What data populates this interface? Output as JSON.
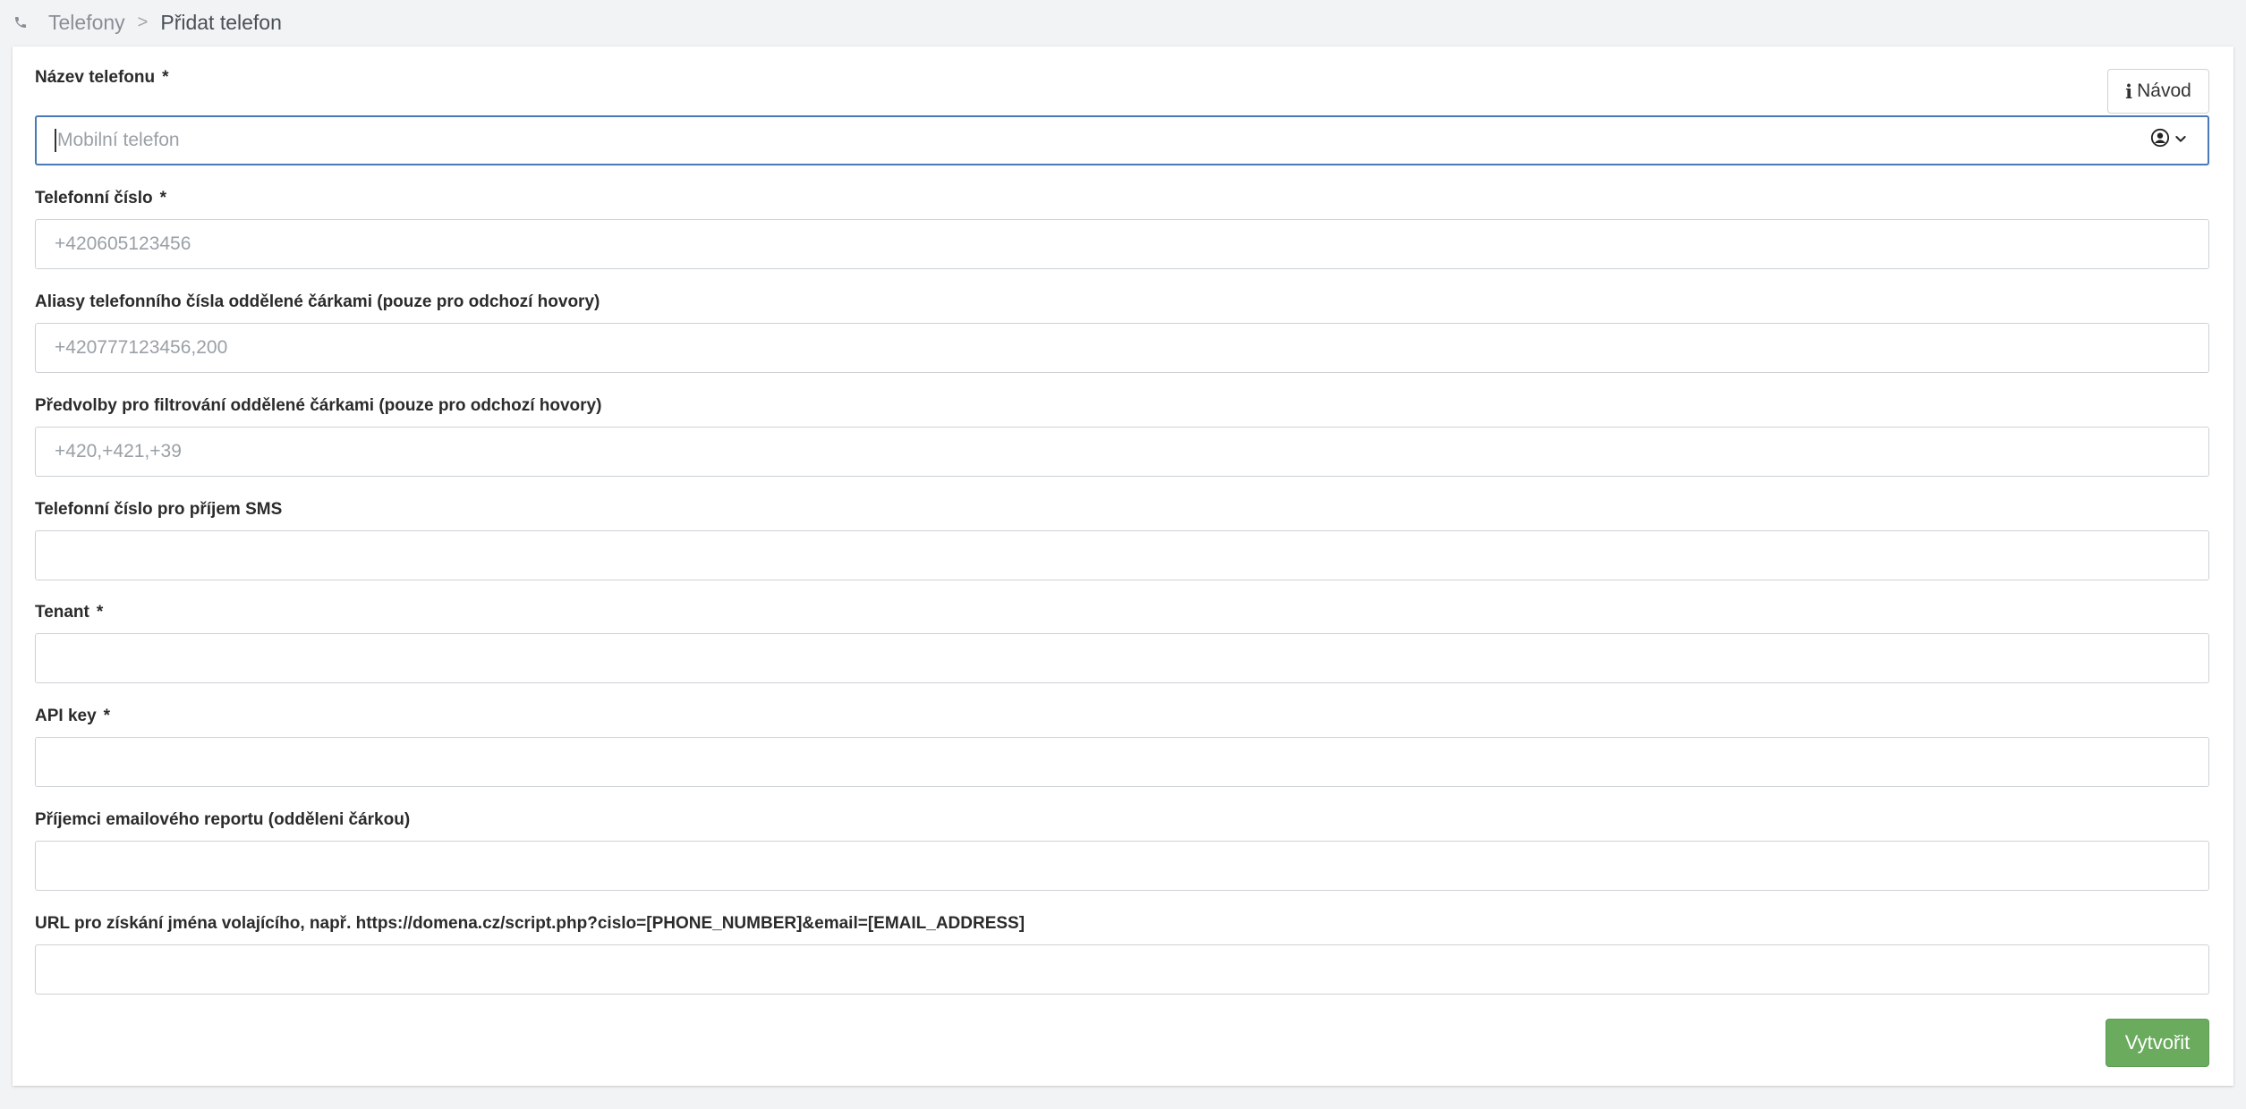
{
  "breadcrumb": {
    "icon": "phone-icon",
    "items": [
      "Telefony",
      "Přidat telefon"
    ],
    "separator": ">"
  },
  "guide_button": {
    "icon": "info-icon",
    "icon_glyph": "i",
    "label": "Návod"
  },
  "form": {
    "required_marker": "*",
    "fields": [
      {
        "label": "Název telefonu",
        "required": true,
        "placeholder": "Mobilní telefon",
        "value": "",
        "type": "select-with-icon",
        "focused": true,
        "icons": [
          "user-circle-icon",
          "chevron-down-icon"
        ]
      },
      {
        "label": "Telefonní číslo",
        "required": true,
        "placeholder": "+420605123456",
        "value": ""
      },
      {
        "label": "Aliasy telefonního čísla oddělené čárkami (pouze pro odchozí hovory)",
        "required": false,
        "placeholder": "+420777123456,200",
        "value": ""
      },
      {
        "label": "Předvolby pro filtrování oddělené čárkami (pouze pro odchozí hovory)",
        "required": false,
        "placeholder": "+420,+421,+39",
        "value": ""
      },
      {
        "label": "Telefonní číslo pro příjem SMS",
        "required": false,
        "placeholder": "",
        "value": ""
      },
      {
        "label": "Tenant",
        "required": true,
        "placeholder": "",
        "value": ""
      },
      {
        "label": "API key",
        "required": true,
        "placeholder": "",
        "value": ""
      },
      {
        "label": "Příjemci emailového reportu (odděleni čárkou)",
        "required": false,
        "placeholder": "",
        "value": ""
      },
      {
        "label": "URL pro získání jména volajícího, např. https://domena.cz/script.php?cislo=[PHONE_NUMBER]&email=[EMAIL_ADDRESS]",
        "required": false,
        "placeholder": "",
        "value": ""
      }
    ]
  },
  "submit_button": {
    "label": "Vytvořit"
  },
  "colors": {
    "focus_border": "#4a78b8",
    "submit_bg": "#6aab5e",
    "page_bg": "#f2f3f5"
  }
}
